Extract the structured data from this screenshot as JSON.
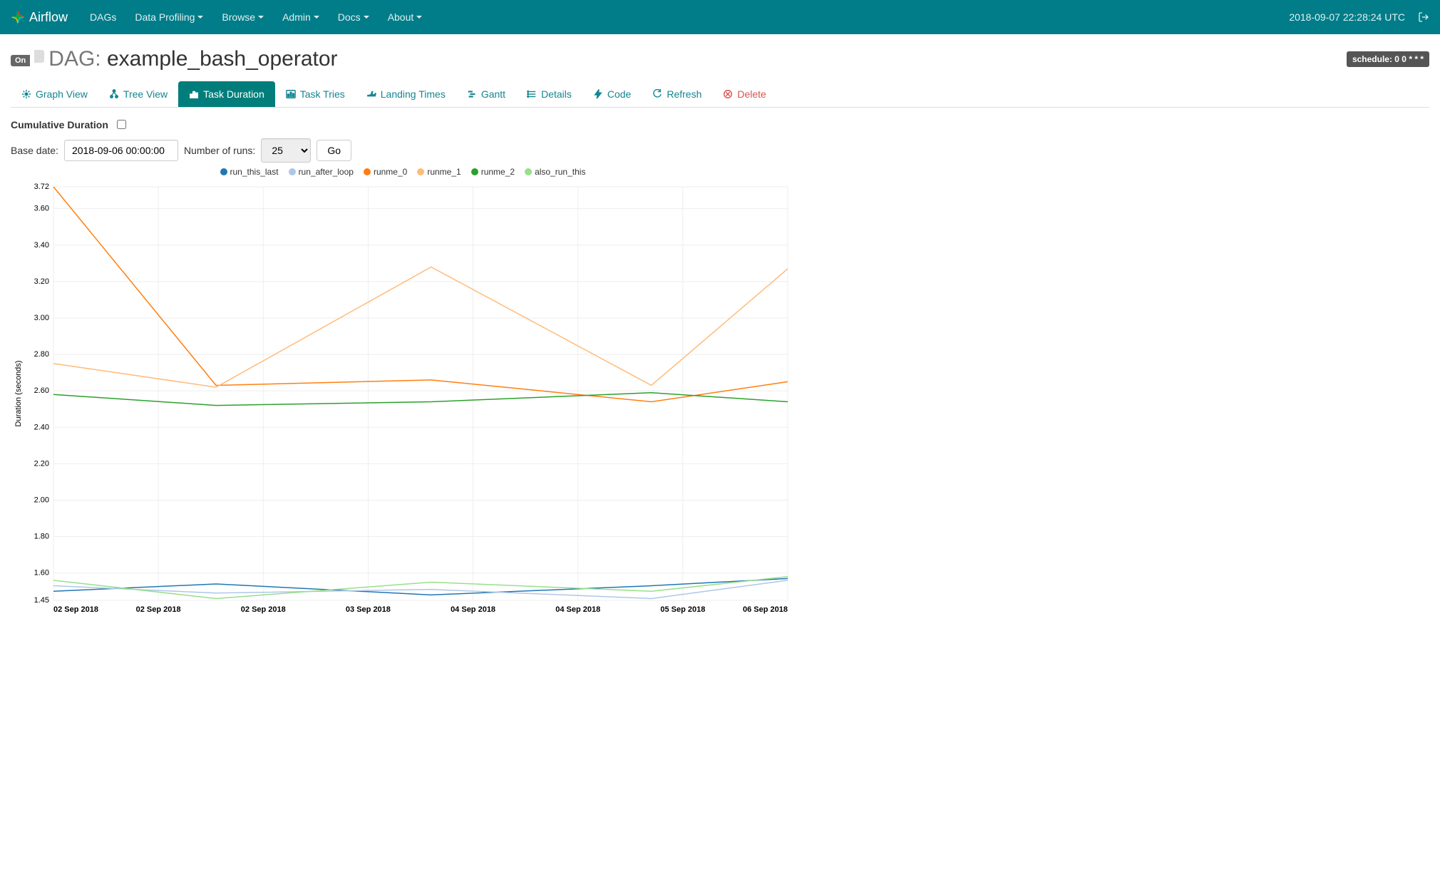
{
  "navbar": {
    "brand": "Airflow",
    "items": [
      "DAGs",
      "Data Profiling",
      "Browse",
      "Admin",
      "Docs",
      "About"
    ],
    "items_dropdown": [
      false,
      true,
      true,
      true,
      true,
      true
    ],
    "utc": "2018-09-07 22:28:24 UTC"
  },
  "header": {
    "toggle": "On",
    "prefix": "DAG:",
    "dag_id": "example_bash_operator",
    "schedule_label": "schedule: 0 0 * * *"
  },
  "tabs": [
    {
      "icon": "burst",
      "label": "Graph View"
    },
    {
      "icon": "tree",
      "label": "Tree View"
    },
    {
      "icon": "bars",
      "label": "Task Duration",
      "active": true
    },
    {
      "icon": "chart",
      "label": "Task Tries"
    },
    {
      "icon": "plane",
      "label": "Landing Times"
    },
    {
      "icon": "gantt",
      "label": "Gantt"
    },
    {
      "icon": "list",
      "label": "Details"
    },
    {
      "icon": "bolt",
      "label": "Code"
    },
    {
      "icon": "refresh",
      "label": "Refresh"
    },
    {
      "icon": "delete",
      "label": "Delete",
      "delete": true
    }
  ],
  "form": {
    "cumulative_label": "Cumulative Duration",
    "base_date_label": "Base date:",
    "base_date_value": "2018-09-06 00:00:00",
    "num_runs_label": "Number of runs:",
    "num_runs_value": "25",
    "go_label": "Go"
  },
  "chart_data": {
    "type": "line",
    "ylabel": "Duration (seconds)",
    "ylim": [
      1.45,
      3.72
    ],
    "y_ticks": [
      1.45,
      1.6,
      1.8,
      2.0,
      2.2,
      2.4,
      2.6,
      2.8,
      3.0,
      3.2,
      3.4,
      3.6,
      3.72
    ],
    "x_tick_labels": [
      "02 Sep 2018",
      "02 Sep 2018",
      "02 Sep 2018",
      "03 Sep 2018",
      "04 Sep 2018",
      "04 Sep 2018",
      "05 Sep 2018",
      "06 Sep 2018"
    ],
    "x_tick_positions": [
      0,
      1,
      2,
      3,
      4,
      5,
      6,
      7
    ],
    "categories_x": [
      0,
      1.55,
      3.6,
      5.7,
      7
    ],
    "series": [
      {
        "name": "run_this_last",
        "color": "#1f77b4",
        "values": [
          1.5,
          1.54,
          1.48,
          1.53,
          1.57
        ]
      },
      {
        "name": "run_after_loop",
        "color": "#aec7e8",
        "values": [
          1.53,
          1.49,
          1.51,
          1.46,
          1.56
        ]
      },
      {
        "name": "runme_0",
        "color": "#ff7f0e",
        "values": [
          3.72,
          2.63,
          2.66,
          2.54,
          2.65
        ]
      },
      {
        "name": "runme_1",
        "color": "#ffbb78",
        "values": [
          2.75,
          2.62,
          3.28,
          2.63,
          3.27
        ]
      },
      {
        "name": "runme_2",
        "color": "#2ca02c",
        "values": [
          2.58,
          2.52,
          2.54,
          2.59,
          2.54
        ]
      },
      {
        "name": "also_run_this",
        "color": "#98df8a",
        "values": [
          1.56,
          1.46,
          1.55,
          1.5,
          1.58
        ]
      }
    ]
  }
}
